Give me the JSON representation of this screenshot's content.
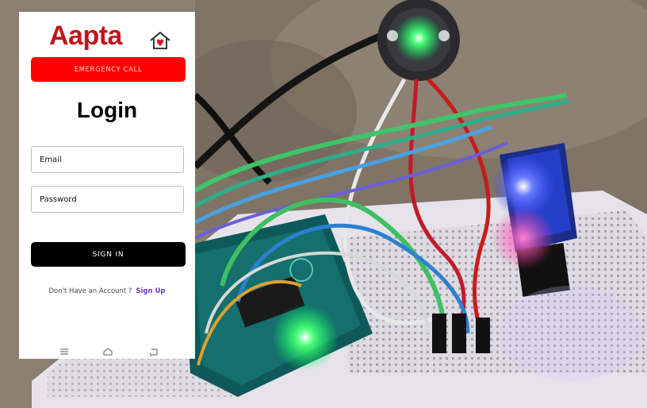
{
  "app": {
    "brand": "Aapta",
    "emergency_label": "EMERGENCY CALL",
    "title": "Login",
    "email_placeholder": "Email",
    "password_placeholder": "Password",
    "signin_label": "SIGN IN",
    "account_prompt": "Don't Have an Account ?",
    "signup_label": "Sign Up"
  },
  "icons": {
    "home": "home-heart-icon",
    "nav_menu": "menu-icon",
    "nav_home": "home-icon",
    "nav_back": "back-icon"
  },
  "colors": {
    "brand": "#c0161b",
    "emergency": "#ff0000",
    "signin": "#000000",
    "signup_link": "#6a3bd1"
  }
}
